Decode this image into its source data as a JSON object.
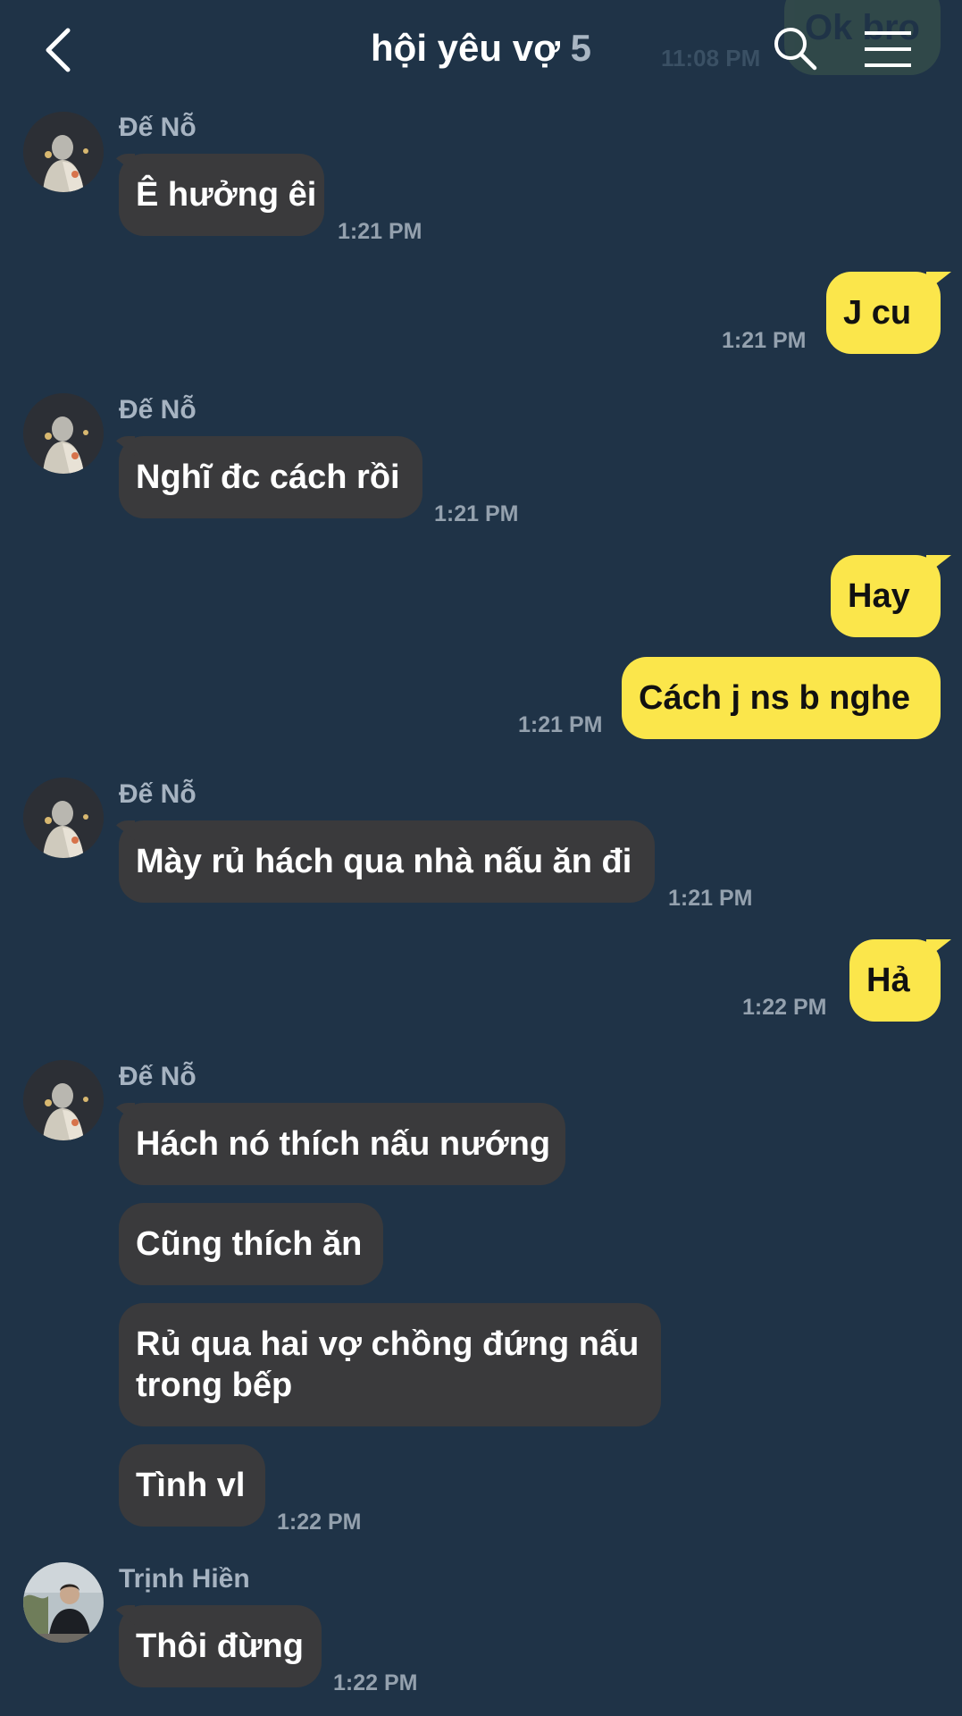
{
  "header": {
    "back_icon": "chevron-left-icon",
    "title": "hội yêu vợ",
    "member_count": "5",
    "search_icon": "search-icon",
    "menu_icon": "hamburger-menu-icon",
    "peek_message": "Ok bro",
    "peek_time": "11:08 PM"
  },
  "messages": [
    {
      "sender": "Đế Nỗ",
      "text": "Ê hưởng êi",
      "time": "1:21 PM"
    },
    {
      "text": "J cu",
      "time": "1:21 PM"
    },
    {
      "sender": "Đế Nỗ",
      "text": "Nghĩ đc cách rồi",
      "time": "1:21 PM"
    },
    {
      "text": "Hay"
    },
    {
      "text": "Cách j ns b nghe",
      "time": "1:21 PM"
    },
    {
      "sender": "Đế Nỗ",
      "text": "Mày rủ hách qua nhà nấu ăn đi",
      "time": "1:21 PM"
    },
    {
      "text": "Hả",
      "time": "1:22 PM"
    },
    {
      "sender": "Đế Nỗ",
      "text": "Hách nó thích nấu nướng"
    },
    {
      "text": "Cũng thích ăn"
    },
    {
      "text": "Rủ qua hai vợ chồng đứng nấu trong bếp"
    },
    {
      "text": "Tình vl",
      "time": "1:22 PM"
    },
    {
      "sender": "Trịnh Hiền",
      "text": "Thôi đừng",
      "time": "1:22 PM"
    }
  ],
  "colors": {
    "background": "#1f3347",
    "incoming_bubble": "#3a3a3c",
    "outgoing_bubble": "#fbe64b",
    "timestamp": "#94a1ae",
    "sender_name": "#a6b3c1"
  }
}
